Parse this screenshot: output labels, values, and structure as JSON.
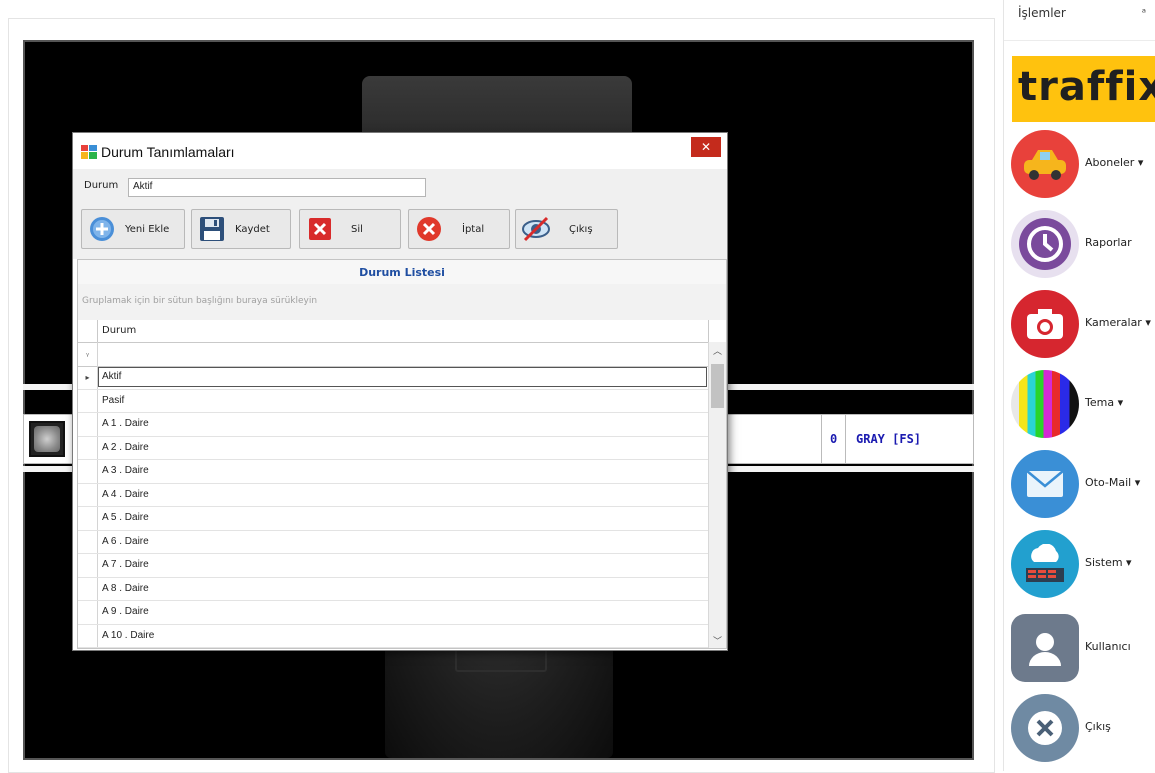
{
  "dialog": {
    "title": "Durum Tanımlamaları",
    "close_label": "✕",
    "field_label": "Durum",
    "field_value": "Aktif",
    "toolbar": {
      "new_label": "Yeni Ekle",
      "save_label": "Kaydet",
      "delete_label": "Sil",
      "cancel_label": "İptal",
      "exit_label": "Çıkış"
    },
    "grid": {
      "title": "Durum Listesi",
      "group_hint": "Gruplamak için bir sütun başlığını buraya sürükleyin",
      "column_header": "Durum",
      "rows": [
        "Aktif",
        "Pasif",
        "A 1 . Daire",
        "A 2 . Daire",
        "A 3 . Daire",
        "A 4 . Daire",
        "A 5 . Daire",
        "A 6 . Daire",
        "A 7 . Daire",
        "A 8 . Daire",
        "A 9 . Daire",
        "A 10 . Daire"
      ],
      "selected_index": 0
    }
  },
  "record": {
    "count": "0",
    "color_code": "GRAY [FS]"
  },
  "sidebar": {
    "header": "İşlemler",
    "pin": "ᵃ",
    "brand": "traffix",
    "brand_chevrons": "«",
    "items": [
      {
        "label": "Aboneler ▾",
        "icon": "car-icon",
        "color": "#e8413b"
      },
      {
        "label": "Raporlar",
        "icon": "history-icon",
        "color": "#7a4a9c"
      },
      {
        "label": "Kameralar ▾",
        "icon": "camera-icon",
        "color": "#d6262f"
      },
      {
        "label": "Tema ▾",
        "icon": "color-bars-icon",
        "color": "#333333"
      },
      {
        "label": "Oto-Mail ▾",
        "icon": "mail-icon",
        "color": "#3a8fd6"
      },
      {
        "label": "Sistem ▾",
        "icon": "cloud-server-icon",
        "color": "#22a0cf"
      },
      {
        "label": "Kullanıcı",
        "icon": "user-icon",
        "color": "#6d7a8c"
      },
      {
        "label": "Çıkış",
        "icon": "close-circle-icon",
        "color": "#6f8aa3"
      }
    ]
  }
}
